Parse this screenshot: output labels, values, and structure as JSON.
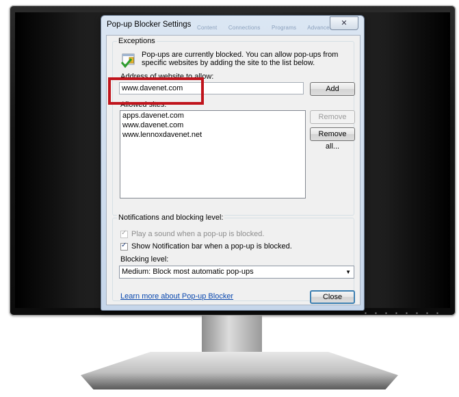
{
  "dialog": {
    "title": "Pop-up Blocker Settings",
    "close_glyph": "✕",
    "background_tabs": [
      "Content",
      "Connections",
      "Programs",
      "Advanced"
    ]
  },
  "exceptions": {
    "group_label": "Exceptions",
    "info_text": "Pop-ups are currently blocked.  You can allow pop-ups from specific websites by adding the site to the list below.",
    "address_label": "Address of website to allow:",
    "address_value": "www.davenet.com",
    "add_button": "Add",
    "allowed_sites_label": "Allowed sites:",
    "allowed_sites": [
      "apps.davenet.com",
      "www.davenet.com",
      "www.lennoxdavenet.net"
    ],
    "remove_button": "Remove",
    "remove_all_button": "Remove all..."
  },
  "notifications": {
    "group_label": "Notifications and blocking level:",
    "play_sound_label": "Play a sound when a pop-up is blocked.",
    "play_sound_checked": true,
    "play_sound_enabled": false,
    "show_bar_label": "Show Notification bar when a pop-up is blocked.",
    "show_bar_checked": true,
    "blocking_level_label": "Blocking level:",
    "blocking_level_value": "Medium: Block most automatic pop-ups"
  },
  "footer": {
    "learn_more_link": "Learn more about Pop-up Blocker",
    "close_button": "Close"
  },
  "colors": {
    "highlight_box": "#c0141c",
    "link": "#0645ad"
  }
}
